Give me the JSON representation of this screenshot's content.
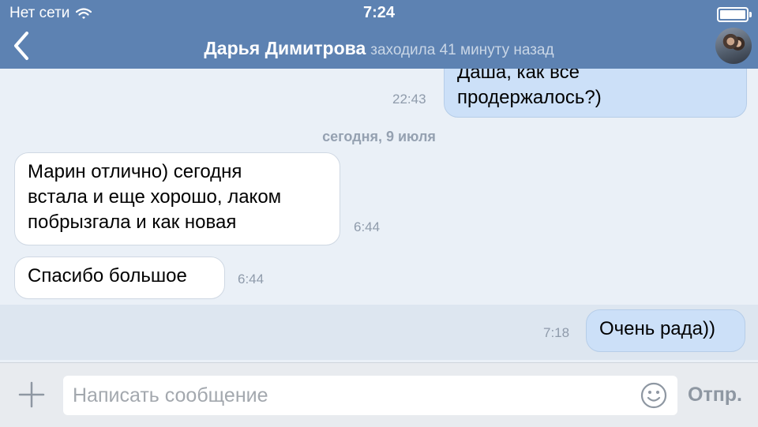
{
  "status_bar": {
    "carrier": "Нет сети",
    "time": "7:24",
    "wifi_icon": "wifi-icon",
    "battery_icon": "battery-icon"
  },
  "header": {
    "back_icon": "chevron-left-icon",
    "contact_name": "Дарья Димитрова",
    "last_seen": "заходила 41 минуту назад",
    "avatar": "contact-avatar"
  },
  "colors": {
    "header_bg": "#5d82b2",
    "outgoing_bubble": "#cce0f8",
    "incoming_bubble": "#ffffff",
    "chat_bg": "#eaf0f7"
  },
  "messages": [
    {
      "direction": "out",
      "text_lines": [
        "Даша, как все",
        "продержалось?)"
      ],
      "time": "22:43"
    },
    {
      "direction": "in",
      "text_lines": [
        "Марин отлично) сегодня",
        "встала и еще хорошо, лаком",
        "побрызгала и как новая"
      ],
      "time": "6:44"
    },
    {
      "direction": "in",
      "text_lines": [
        "Спасибо большое"
      ],
      "time": "6:44"
    },
    {
      "direction": "out",
      "text_lines": [
        "Очень рада))"
      ],
      "time": "7:18"
    }
  ],
  "date_separator": "сегодня, 9 июля",
  "composer": {
    "attach_icon": "plus-icon",
    "placeholder": "Написать сообщение",
    "value": "",
    "emoji_icon": "smiley-icon",
    "send_label": "Отпр."
  }
}
